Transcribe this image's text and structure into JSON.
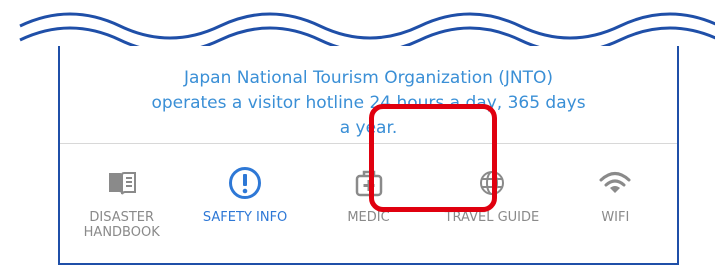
{
  "message": {
    "line1": "Japan National Tourism Organization (JNTO)",
    "line2": "operates a visitor hotline 24 hours a day, 365 days",
    "line3": "a year."
  },
  "nav": {
    "items": [
      {
        "label": "DISASTER\nHANDBOOK",
        "icon": "book-icon",
        "active": false
      },
      {
        "label": "SAFETY INFO",
        "icon": "exclamation-circle-icon",
        "active": true
      },
      {
        "label": "MEDIC",
        "icon": "medical-kit-icon",
        "active": false
      },
      {
        "label": "TRAVEL GUIDE",
        "icon": "globe-icon",
        "active": false
      },
      {
        "label": "WIFI",
        "icon": "wifi-icon",
        "active": false
      }
    ]
  },
  "colors": {
    "accent": "#2e78d6",
    "message_text": "#3a8fd6",
    "inactive": "#8a8a8a",
    "frame": "#1f4fa8",
    "highlight": "#e0000f"
  }
}
